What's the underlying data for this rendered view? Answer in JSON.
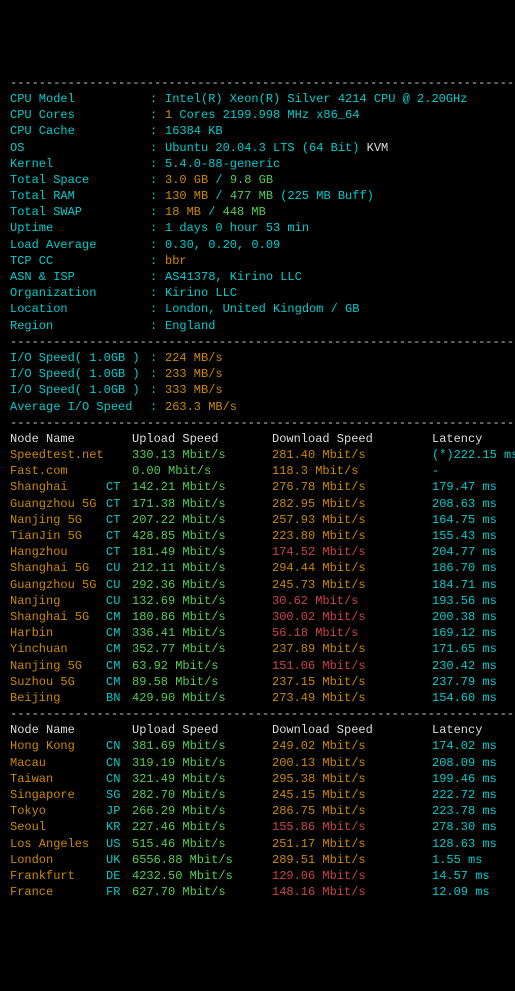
{
  "sys": {
    "labels": {
      "cpu_model": "CPU Model",
      "cpu_cores": "CPU Cores",
      "cpu_cache": "CPU Cache",
      "os": "OS",
      "kernel": "Kernel",
      "total_space": "Total Space",
      "total_ram": "Total RAM",
      "total_swap": "Total SWAP",
      "uptime": "Uptime",
      "load_avg": "Load Average",
      "tcp_cc": "TCP CC",
      "asn_isp": "ASN & ISP",
      "org": "Organization",
      "location": "Location",
      "region": "Region"
    },
    "vals": {
      "cpu_model": "Intel(R) Xeon(R) Silver 4214 CPU @ 2.20GHz",
      "cpu_cores_a": "1",
      "cpu_cores_b": " Cores 2199.998 MHz x86_64",
      "cpu_cache": "16384 KB",
      "os_a": "Ubuntu 20.04.3 LTS (64 Bit)",
      "os_b": " KVM",
      "kernel": "5.4.0-88-generic",
      "space_a": "3.0 GB ",
      "space_mid": "/",
      "space_b": " 9.8 GB",
      "ram_a": "130 MB ",
      "ram_mid": "/",
      "ram_b": " 477 MB ",
      "ram_c": "(225 MB Buff)",
      "swap_a": "18 MB ",
      "swap_mid": "/",
      "swap_b": " 448 MB",
      "uptime": "1 days 0 hour 53 min",
      "load_avg": "0.30, 0.20, 0.09",
      "tcp_cc": "bbr",
      "asn_isp": "AS41378, Kirino LLC",
      "org": "Kirino LLC",
      "location": "London, United Kingdom / GB",
      "region": "England"
    }
  },
  "io": {
    "labels": {
      "test": "I/O Speed( 1.0GB )",
      "avg": "Average I/O Speed"
    },
    "v1": "224 MB/s",
    "v2": "233 MB/s",
    "v3": "333 MB/s",
    "avg": "263.3 MB/s"
  },
  "speed": {
    "head": {
      "node": "Node Name",
      "up": "Upload Speed",
      "down": "Download Speed",
      "lat": "Latency"
    },
    "rows1": [
      {
        "name": "Speedtest.net",
        "cc": "",
        "up": "330.13 Mbit/s",
        "down": "281.40 Mbit/s",
        "lat": "(*)222.15 ms",
        "dc": "or"
      },
      {
        "name": "Fast.com",
        "cc": "",
        "up": "0.00 Mbit/s",
        "down": "118.3 Mbit/s",
        "lat": "-",
        "dc": "or"
      },
      {
        "name": "Shanghai",
        "cc": "CT",
        "up": "142.21 Mbit/s",
        "down": "276.78 Mbit/s",
        "lat": "179.47 ms",
        "dc": "or"
      },
      {
        "name": "Guangzhou 5G",
        "cc": "CT",
        "up": "171.38 Mbit/s",
        "down": "282.95 Mbit/s",
        "lat": "208.63 ms",
        "dc": "or"
      },
      {
        "name": "Nanjing 5G",
        "cc": "CT",
        "up": "207.22 Mbit/s",
        "down": "257.93 Mbit/s",
        "lat": "164.75 ms",
        "dc": "or"
      },
      {
        "name": "TianJin 5G",
        "cc": "CT",
        "up": "428.85 Mbit/s",
        "down": "223.80 Mbit/s",
        "lat": "155.43 ms",
        "dc": "or"
      },
      {
        "name": "Hangzhou",
        "cc": "CT",
        "up": "181.49 Mbit/s",
        "down": "174.52 Mbit/s",
        "lat": "204.77 ms",
        "dc": "rd"
      },
      {
        "name": "Shanghai 5G",
        "cc": "CU",
        "up": "212.11 Mbit/s",
        "down": "294.44 Mbit/s",
        "lat": "186.70 ms",
        "dc": "or"
      },
      {
        "name": "Guangzhou 5G",
        "cc": "CU",
        "up": "292.36 Mbit/s",
        "down": "245.73 Mbit/s",
        "lat": "184.71 ms",
        "dc": "or"
      },
      {
        "name": "Nanjing",
        "cc": "CU",
        "up": "132.69 Mbit/s",
        "down": "30.62 Mbit/s",
        "lat": "193.56 ms",
        "dc": "rd"
      },
      {
        "name": "Shanghai 5G",
        "cc": "CM",
        "up": "180.86 Mbit/s",
        "down": "300.02 Mbit/s",
        "lat": "200.38 ms",
        "dc": "rd"
      },
      {
        "name": "Harbin",
        "cc": "CM",
        "up": "336.41 Mbit/s",
        "down": "56.18 Mbit/s",
        "lat": "169.12 ms",
        "dc": "rd"
      },
      {
        "name": "Yinchuan",
        "cc": "CM",
        "up": "352.77 Mbit/s",
        "down": "237.89 Mbit/s",
        "lat": "171.65 ms",
        "dc": "or"
      },
      {
        "name": "Nanjing 5G",
        "cc": "CM",
        "up": "63.92 Mbit/s",
        "down": "151.06 Mbit/s",
        "lat": "230.42 ms",
        "dc": "rd"
      },
      {
        "name": "Suzhou 5G",
        "cc": "CM",
        "up": "89.58 Mbit/s",
        "down": "237.15 Mbit/s",
        "lat": "237.79 ms",
        "dc": "or"
      },
      {
        "name": "Beijing",
        "cc": "BN",
        "up": "429.90 Mbit/s",
        "down": "273.49 Mbit/s",
        "lat": "154.60 ms",
        "dc": "or"
      }
    ],
    "rows2": [
      {
        "name": "Hong Kong",
        "cc": "CN",
        "up": "381.69 Mbit/s",
        "down": "249.02 Mbit/s",
        "lat": "174.02 ms",
        "dc": "or"
      },
      {
        "name": "Macau",
        "cc": "CN",
        "up": "319.19 Mbit/s",
        "down": "200.13 Mbit/s",
        "lat": "208.09 ms",
        "dc": "or"
      },
      {
        "name": "Taiwan",
        "cc": "CN",
        "up": "321.49 Mbit/s",
        "down": "295.38 Mbit/s",
        "lat": "199.46 ms",
        "dc": "or"
      },
      {
        "name": "Singapore",
        "cc": "SG",
        "up": "282.70 Mbit/s",
        "down": "245.15 Mbit/s",
        "lat": "222.72 ms",
        "dc": "or"
      },
      {
        "name": "Tokyo",
        "cc": "JP",
        "up": "266.29 Mbit/s",
        "down": "286.75 Mbit/s",
        "lat": "223.78 ms",
        "dc": "or"
      },
      {
        "name": "Seoul",
        "cc": "KR",
        "up": "227.46 Mbit/s",
        "down": "155.86 Mbit/s",
        "lat": "278.30 ms",
        "dc": "rd"
      },
      {
        "name": "Los Angeles",
        "cc": "US",
        "up": "515.46 Mbit/s",
        "down": "251.17 Mbit/s",
        "lat": "128.63 ms",
        "dc": "or"
      },
      {
        "name": "London",
        "cc": "UK",
        "up": "6556.88 Mbit/s",
        "down": "289.51 Mbit/s",
        "lat": "1.55 ms",
        "dc": "or"
      },
      {
        "name": "Frankfurt",
        "cc": "DE",
        "up": "4232.50 Mbit/s",
        "down": "129.06 Mbit/s",
        "lat": "14.57 ms",
        "dc": "rd"
      },
      {
        "name": "France",
        "cc": "FR",
        "up": "627.70 Mbit/s",
        "down": "148.16 Mbit/s",
        "lat": "12.09 ms",
        "dc": "rd"
      }
    ]
  },
  "hr": "----------------------------------------------------------------------"
}
